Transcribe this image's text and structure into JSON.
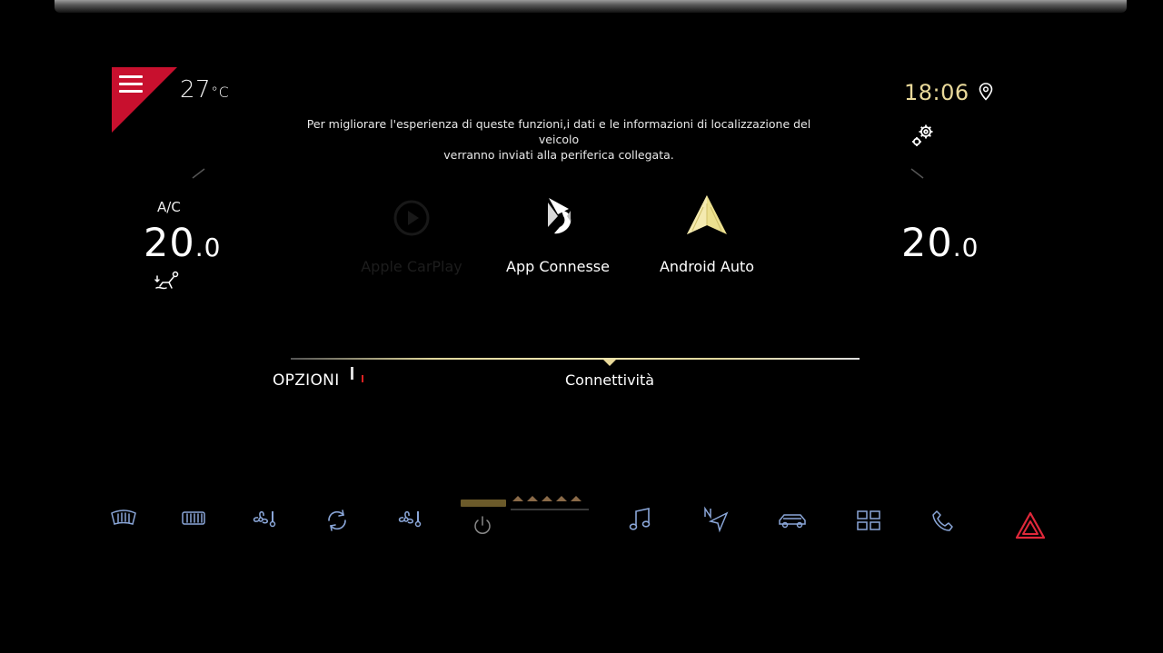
{
  "status": {
    "outside_temp_value": "27",
    "outside_temp_unit": "°C",
    "clock": "18:06"
  },
  "notice": {
    "line1": "Per migliorare l'esperienza di queste funzioni,i dati e le informazioni di localizzazione del veicolo",
    "line2": "verranno inviati alla periferica collegata."
  },
  "climate": {
    "ac_label": "A/C",
    "left_temp_int": "20",
    "left_temp_dec": ".0",
    "right_temp_int": "20",
    "right_temp_dec": ".0"
  },
  "apps": [
    {
      "label": "Apple CarPlay",
      "icon": "carplay-icon"
    },
    {
      "label": "App Connesse",
      "icon": "ds-logo-icon"
    },
    {
      "label": "Android Auto",
      "icon": "android-auto-icon"
    }
  ],
  "tabs": {
    "options": "OPZIONI",
    "connectivity": "Connettività"
  },
  "dock": [
    {
      "icon": "front-defrost-icon"
    },
    {
      "icon": "rear-defrost-icon"
    },
    {
      "icon": "fan-temperature-icon"
    },
    {
      "icon": "air-recirculation-icon"
    },
    {
      "icon": "fan-temperature-icon"
    },
    {
      "icon": "power-icon"
    },
    {
      "icon": "music-icon"
    },
    {
      "icon": "navigation-icon"
    },
    {
      "icon": "car-icon"
    },
    {
      "icon": "apps-grid-icon"
    },
    {
      "icon": "phone-icon"
    },
    {
      "icon": "hazard-icon"
    }
  ],
  "colors": {
    "accent_gold": "#e9d99a",
    "menu_red": "#c8102e",
    "hazard_red": "#e0283a",
    "dock_blue": "#8aa6d8",
    "background": "#000000"
  }
}
